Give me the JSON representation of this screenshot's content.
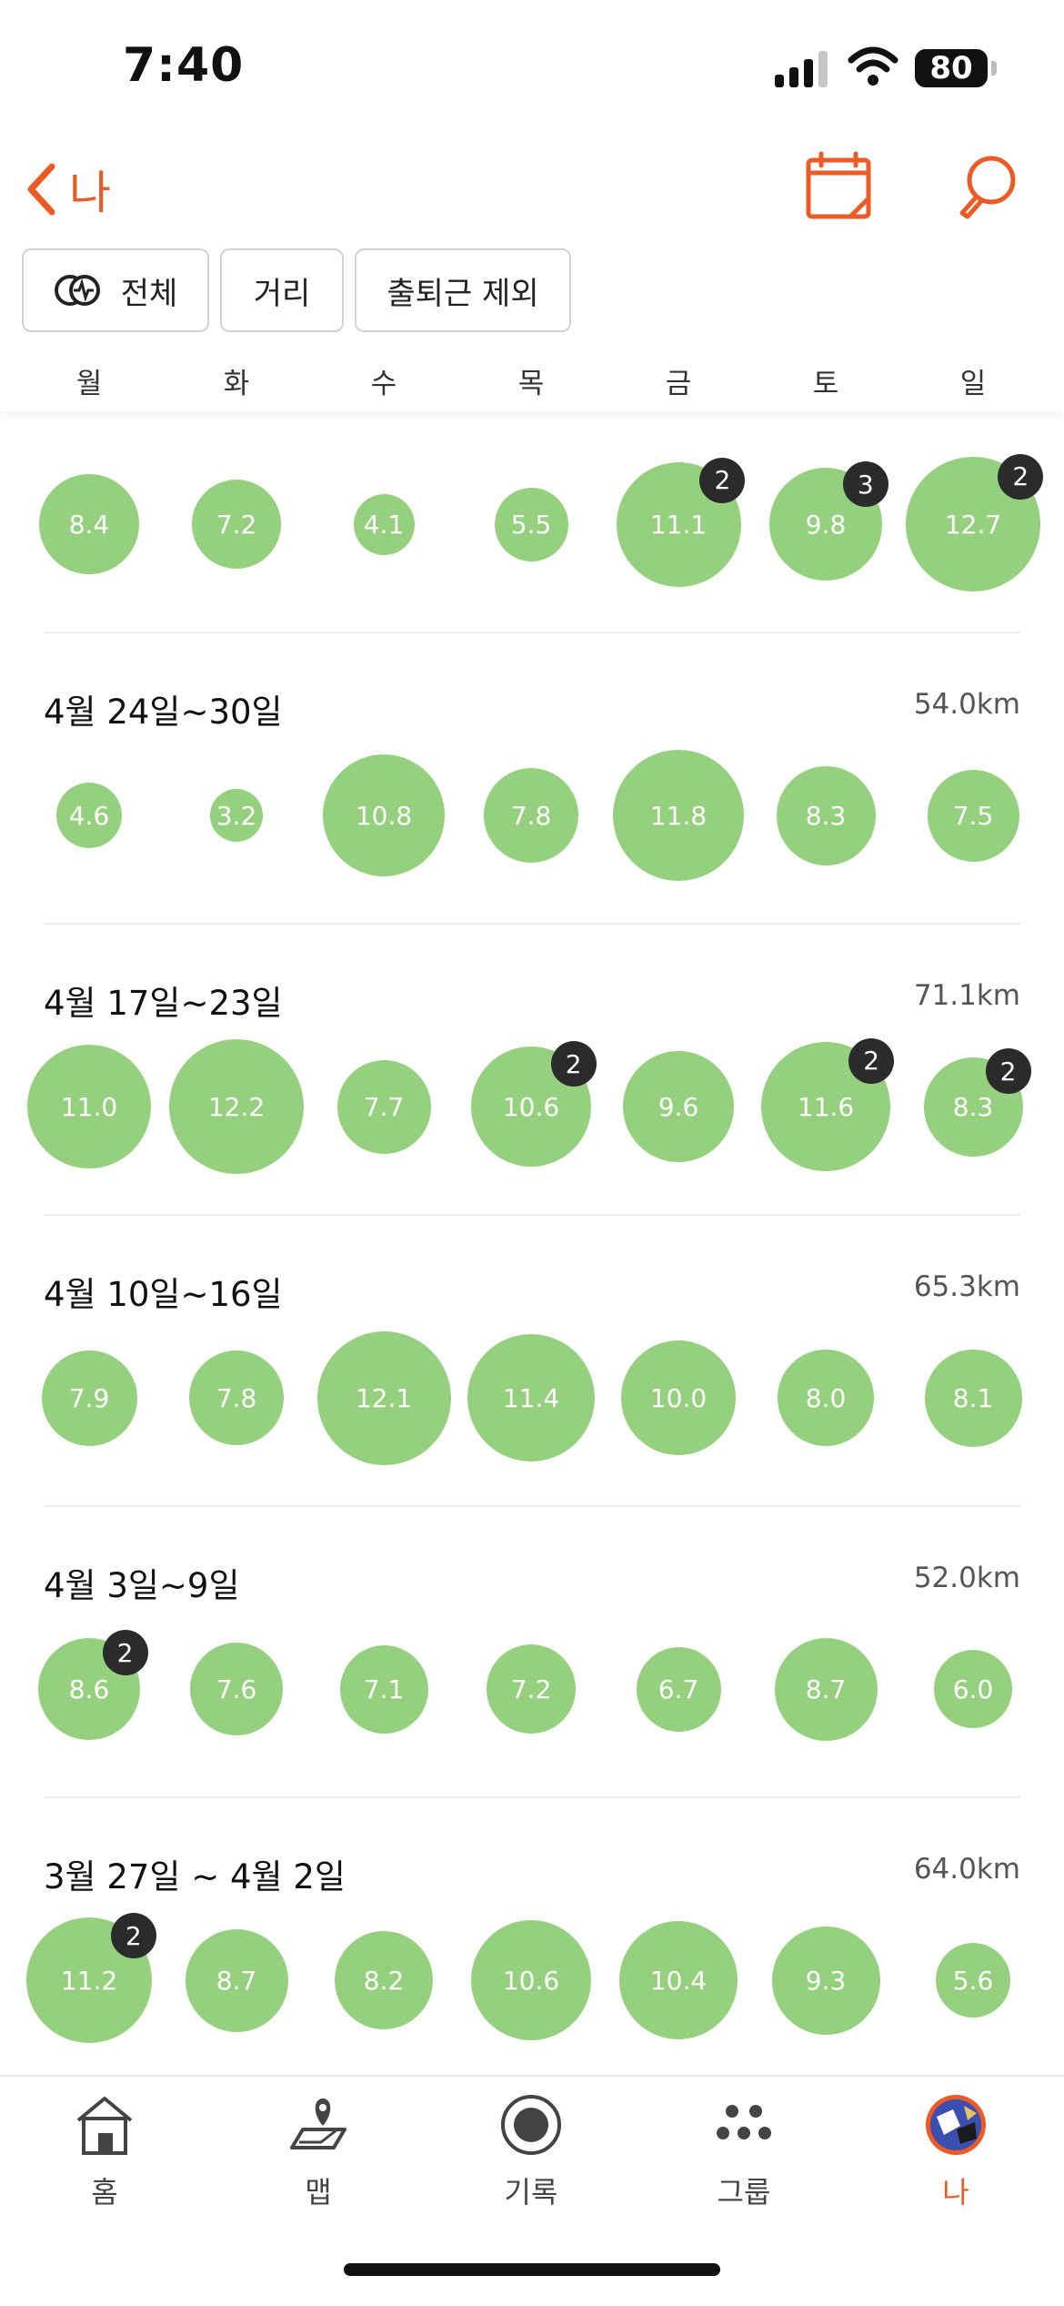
{
  "status_bar": {
    "time": "7:40",
    "battery": "80"
  },
  "header": {
    "back_label": "나",
    "back_icon": "chevron-left-icon",
    "calendar_icon": "calendar-icon",
    "search_icon": "search-icon"
  },
  "filters": [
    {
      "label": "전체",
      "icon": "activity-type-icon"
    },
    {
      "label": "거리"
    },
    {
      "label": "출퇴근 제외"
    }
  ],
  "weekdays": [
    "월",
    "화",
    "수",
    "목",
    "금",
    "토",
    "일"
  ],
  "weeks": [
    {
      "title": "",
      "total": "",
      "days": [
        {
          "value": "8.4",
          "count": null
        },
        {
          "value": "7.2",
          "count": null
        },
        {
          "value": "4.1",
          "count": null
        },
        {
          "value": "5.5",
          "count": null
        },
        {
          "value": "11.1",
          "count": "2"
        },
        {
          "value": "9.8",
          "count": "3"
        },
        {
          "value": "12.7",
          "count": "2"
        }
      ]
    },
    {
      "title": "4월 24일~30일",
      "total": "54.0km",
      "days": [
        {
          "value": "4.6",
          "count": null
        },
        {
          "value": "3.2",
          "count": null
        },
        {
          "value": "10.8",
          "count": null
        },
        {
          "value": "7.8",
          "count": null
        },
        {
          "value": "11.8",
          "count": null
        },
        {
          "value": "8.3",
          "count": null
        },
        {
          "value": "7.5",
          "count": null
        }
      ]
    },
    {
      "title": "4월 17일~23일",
      "total": "71.1km",
      "days": [
        {
          "value": "11.0",
          "count": null
        },
        {
          "value": "12.2",
          "count": null
        },
        {
          "value": "7.7",
          "count": null
        },
        {
          "value": "10.6",
          "count": "2"
        },
        {
          "value": "9.6",
          "count": null
        },
        {
          "value": "11.6",
          "count": "2"
        },
        {
          "value": "8.3",
          "count": "2"
        }
      ]
    },
    {
      "title": "4월 10일~16일",
      "total": "65.3km",
      "days": [
        {
          "value": "7.9",
          "count": null
        },
        {
          "value": "7.8",
          "count": null
        },
        {
          "value": "12.1",
          "count": null
        },
        {
          "value": "11.4",
          "count": null
        },
        {
          "value": "10.0",
          "count": null
        },
        {
          "value": "8.0",
          "count": null
        },
        {
          "value": "8.1",
          "count": null
        }
      ]
    },
    {
      "title": "4월 3일~9일",
      "total": "52.0km",
      "days": [
        {
          "value": "8.6",
          "count": "2"
        },
        {
          "value": "7.6",
          "count": null
        },
        {
          "value": "7.1",
          "count": null
        },
        {
          "value": "7.2",
          "count": null
        },
        {
          "value": "6.7",
          "count": null
        },
        {
          "value": "8.7",
          "count": null
        },
        {
          "value": "6.0",
          "count": null
        }
      ]
    },
    {
      "title": "3월 27일 ~ 4월 2일",
      "total": "64.0km",
      "days": [
        {
          "value": "11.2",
          "count": "2"
        },
        {
          "value": "8.7",
          "count": null
        },
        {
          "value": "8.2",
          "count": null
        },
        {
          "value": "10.6",
          "count": null
        },
        {
          "value": "10.4",
          "count": null
        },
        {
          "value": "9.3",
          "count": null
        },
        {
          "value": "5.6",
          "count": null
        }
      ]
    }
  ],
  "tabs": [
    {
      "label": "홈",
      "icon": "home-icon",
      "active": false
    },
    {
      "label": "맵",
      "icon": "map-icon",
      "active": false
    },
    {
      "label": "기록",
      "icon": "record-icon",
      "active": false
    },
    {
      "label": "그룹",
      "icon": "group-icon",
      "active": false
    },
    {
      "label": "나",
      "icon": "avatar",
      "active": true
    }
  ],
  "colors": {
    "accent": "#ea5b25",
    "bubble": "#95d07e",
    "badge": "#2b2b2b"
  }
}
